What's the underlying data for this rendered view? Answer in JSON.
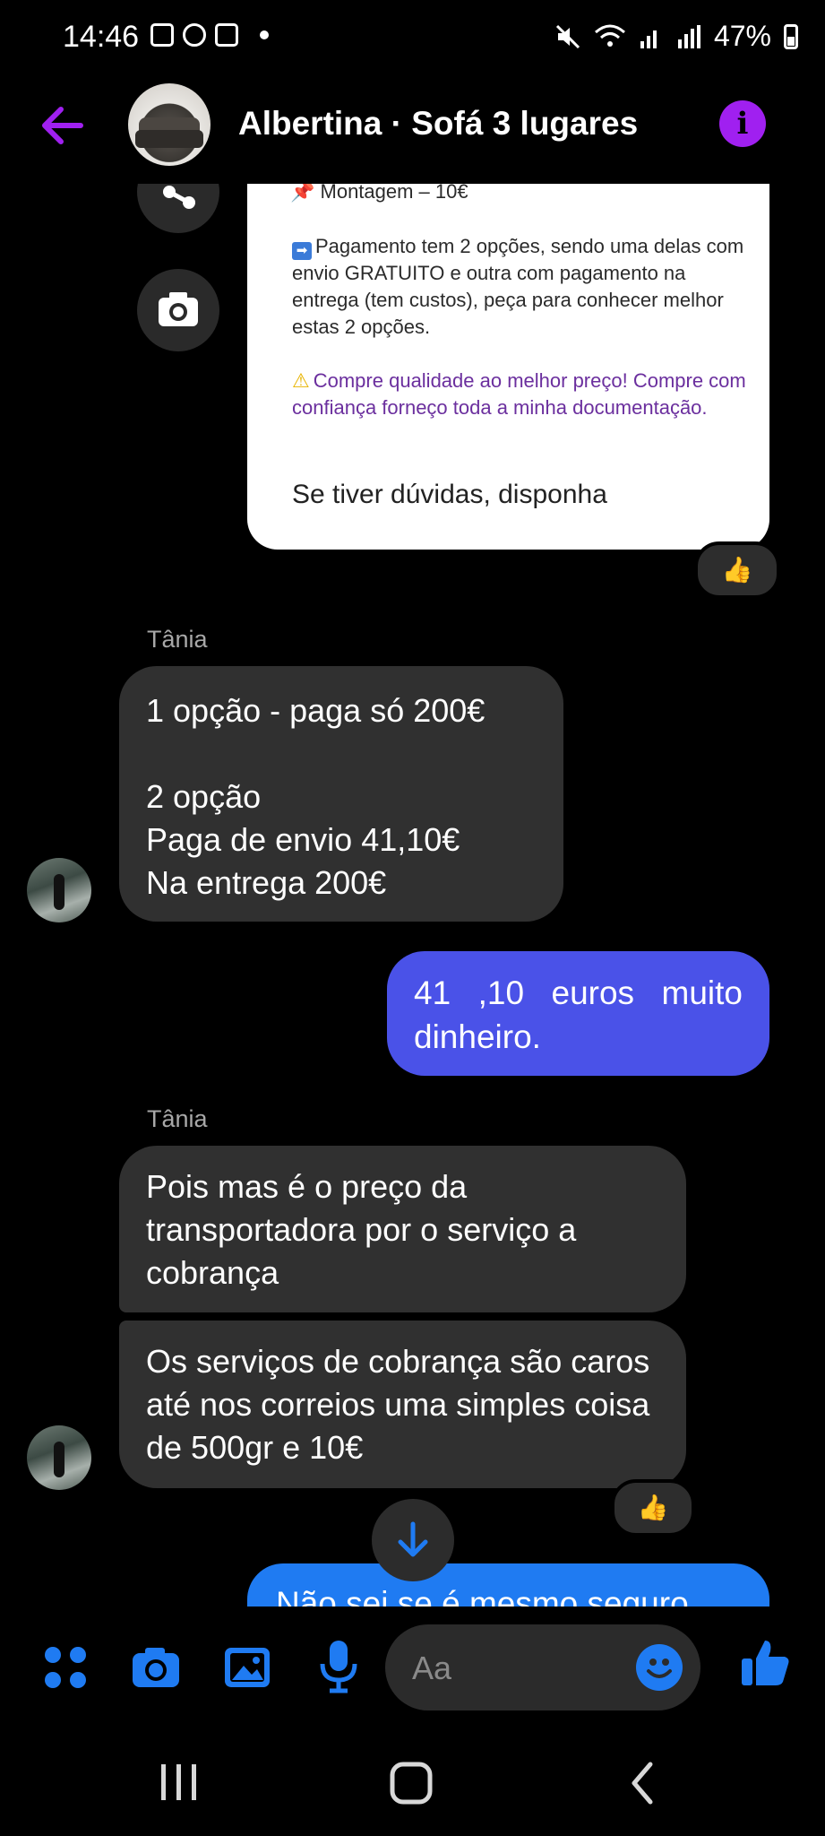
{
  "status_bar": {
    "time": "14:46",
    "battery": "47%"
  },
  "header": {
    "title": "Albertina · Sofá 3 lugares"
  },
  "card": {
    "top_line": "📌 Montagem – 10€",
    "payment_text": "Pagamento tem 2 opções, sendo uma delas com envio GRATUITO e outra com pagamento na entrega (tem custos), peça para conhecer melhor estas 2 opções.",
    "quality_text": "Compre qualidade ao melhor preço! Compre com confiança forneço toda a minha documentação.",
    "closing": "Se tiver dúvidas, disponha"
  },
  "reaction_emoji": "👍",
  "messages": [
    {
      "sender": "Tânia",
      "lines": [
        "1 opção - paga só 200€",
        "",
        "2 opção",
        "Paga de envio 41,10€",
        "Na entrega 200€"
      ]
    },
    {
      "outgoing": "41 ,10  euros   muito dinheiro."
    },
    {
      "sender": "Tânia",
      "text": "Pois mas é o preço da transportadora por o serviço a cobrança"
    },
    {
      "text": "Os serviços de cobrança são caros até nos correios uma simples coisa de 500gr e 10€"
    },
    {
      "outgoing_partial": "Não sei se é mesmo seguro"
    }
  ],
  "composer": {
    "placeholder": "Aa"
  }
}
